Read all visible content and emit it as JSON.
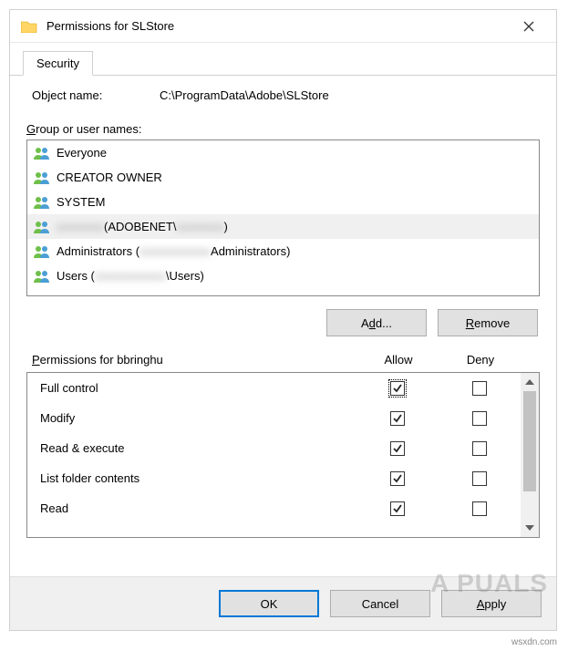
{
  "title": "Permissions for SLStore",
  "tab": "Security",
  "object_label": "Object name:",
  "object_path": "C:\\ProgramData\\Adobe\\SLStore",
  "group_label": "Group or user names:",
  "users": [
    {
      "name": "Everyone",
      "selected": false,
      "redacted_mid": false,
      "redacted_tail": false
    },
    {
      "name": "CREATOR OWNER",
      "selected": false,
      "redacted_mid": false,
      "redacted_tail": false
    },
    {
      "name": "SYSTEM",
      "selected": false,
      "redacted_mid": false,
      "redacted_tail": false
    },
    {
      "name": "",
      "prefix_blur": true,
      "mid": " (ADOBENET\\",
      "mid_after_blur": true,
      "tail": ")",
      "selected": true
    },
    {
      "name": "Administrators (",
      "mid_blur": true,
      "tail": "Administrators)",
      "selected": false
    },
    {
      "name": "Users (",
      "mid_blur": true,
      "tail": "\\Users)",
      "selected": false
    }
  ],
  "add_label": "Add...",
  "remove_label": "Remove",
  "perm_header": "Permissions for bbringhu",
  "allow_label": "Allow",
  "deny_label": "Deny",
  "permissions": [
    {
      "name": "Full control",
      "allow": true,
      "deny": false,
      "focus": true
    },
    {
      "name": "Modify",
      "allow": true,
      "deny": false
    },
    {
      "name": "Read & execute",
      "allow": true,
      "deny": false
    },
    {
      "name": "List folder contents",
      "allow": true,
      "deny": false
    },
    {
      "name": "Read",
      "allow": true,
      "deny": false
    }
  ],
  "ok_label": "OK",
  "cancel_label": "Cancel",
  "apply_label": "Apply",
  "watermark_text": "A  PUALS",
  "source_text": "wsxdn.com"
}
